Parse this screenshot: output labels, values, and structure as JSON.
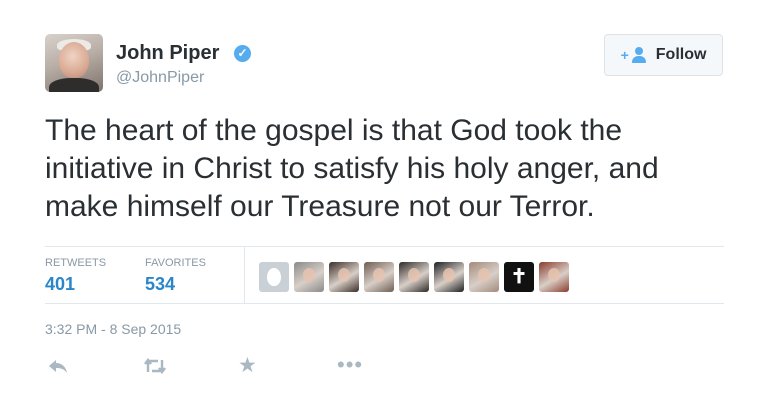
{
  "author": {
    "name": "John Piper",
    "handle": "@JohnPiper",
    "verified": true
  },
  "follow_button": {
    "label": "Follow",
    "icon": "add-user-icon",
    "accent": "#55acee"
  },
  "tweet": {
    "text": "The heart of the gospel is that God took the initiative in Christ to satisfy his holy anger, and make himself our Treasure not our Terror."
  },
  "stats": {
    "retweets_label": "RETWEETS",
    "retweets_count": "401",
    "favorites_label": "FAVORITES",
    "favorites_count": "534"
  },
  "favoriters": [
    {
      "icon": "default-egg-avatar",
      "color": "#c9d0d6"
    },
    {
      "icon": "photo-avatar",
      "color": "#8a8a8a"
    },
    {
      "icon": "photo-avatar",
      "color": "#3a2e27"
    },
    {
      "icon": "photo-avatar",
      "color": "#6f5d52"
    },
    {
      "icon": "photo-avatar",
      "color": "#2f2a27"
    },
    {
      "icon": "photo-avatar",
      "color": "#1f1f22"
    },
    {
      "icon": "photo-avatar",
      "color": "#a48a7b"
    },
    {
      "icon": "cross-avatar",
      "color": "#111111"
    },
    {
      "icon": "photo-avatar",
      "color": "#8a3b2c"
    }
  ],
  "timestamp": "3:32 PM - 8 Sep 2015",
  "actions": {
    "reply": "reply-icon",
    "retweet": "retweet-icon",
    "favorite": "star-icon",
    "more": "more-icon"
  },
  "colors": {
    "link_blue": "#2a86c9",
    "muted_gray": "#8899a6",
    "icon_gray": "#aab8c2",
    "verified_blue": "#55acee"
  }
}
